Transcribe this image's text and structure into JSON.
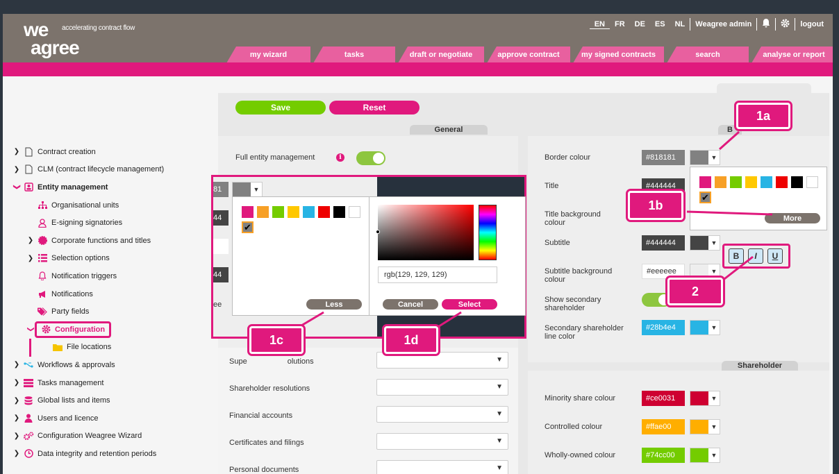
{
  "logo": {
    "we": "we",
    "agree": "agree",
    "tagline": "accelerating contract flow"
  },
  "topnav": {
    "langs": [
      "EN",
      "FR",
      "DE",
      "ES",
      "NL"
    ],
    "user": "Weagree admin",
    "logout": "logout"
  },
  "tabs": [
    "my wizard",
    "tasks",
    "draft or negotiate",
    "approve contract",
    "my signed contracts",
    "search",
    "analyse or report"
  ],
  "sidebar": {
    "contract_creation": "Contract creation",
    "clm": "CLM (contract lifecycle management)",
    "entity_management": "Entity management",
    "org_units": "Organisational units",
    "esign": "E-signing signatories",
    "corporate": "Corporate functions and titles",
    "selection": "Selection options",
    "notif_triggers": "Notification triggers",
    "notifications": "Notifications",
    "party_fields": "Party fields",
    "configuration": "Configuration",
    "file_locations": "File locations",
    "workflows": "Workflows & approvals",
    "tasks_mgmt": "Tasks management",
    "global_lists": "Global lists and items",
    "users": "Users and licence",
    "config_wizard": "Configuration Weagree Wizard",
    "data_integrity": "Data integrity and retention periods"
  },
  "buttons": {
    "save": "Save",
    "reset": "Reset"
  },
  "sections": {
    "general": "General",
    "shareholder": "Shareholder",
    "right_fragment": "B"
  },
  "general": {
    "full_entity": "Full entity management",
    "rows": [
      "Supervisory board resolutions",
      "Shareholder resolutions",
      "Financial accounts",
      "Certificates and filings",
      "Personal documents"
    ],
    "row_first_visible": "Supe",
    "row_first_tail": "olutions",
    "left_frags": [
      "81",
      "44",
      "44",
      "ee"
    ]
  },
  "colors": {
    "border": {
      "label": "Border colour",
      "hex": "#818181",
      "color": "#818181"
    },
    "title": {
      "label": "Title",
      "hex": "#444444",
      "color": "#444444"
    },
    "title_bg": {
      "label": "Title background colour"
    },
    "subtitle": {
      "label": "Subtitle",
      "hex": "#444444",
      "color": "#444444"
    },
    "subtitle_bg": {
      "label": "Subtitle background colour",
      "hex": "#eeeeee",
      "color": "#eeeeee"
    },
    "show_secondary": {
      "label": "Show secondary shareholder"
    },
    "secondary_line": {
      "label": "Secondary shareholder line color",
      "hex": "#28b4e4",
      "color": "#28b4e4"
    },
    "minority": {
      "label": "Minority share colour",
      "hex": "#ce0031",
      "color": "#ce0031"
    },
    "controlled": {
      "label": "Controlled colour",
      "hex": "#ffae00",
      "color": "#ffae00"
    },
    "wholly": {
      "label": "Wholly-owned colour",
      "hex": "#74cc00",
      "color": "#74cc00"
    }
  },
  "palette": [
    "#e0197d",
    "#f7a026",
    "#74cc00",
    "#ffc800",
    "#28b4e4",
    "#ee0000",
    "#000000",
    "#ffffff",
    "#818181"
  ],
  "picker": {
    "rgb": "rgb(129, 129, 129)",
    "less": "Less",
    "cancel": "Cancel",
    "select": "Select",
    "more": "More"
  },
  "biu": {
    "b": "B",
    "i": "I",
    "u": "U"
  },
  "callouts": {
    "c1a": "1a",
    "c1b": "1b",
    "c1c": "1c",
    "c1d": "1d",
    "c2": "2"
  },
  "icons": {
    "arrow": "▼",
    "check": "✔",
    "chev_right": "❯",
    "chev_down": "❯"
  },
  "accent": "#e0197d"
}
